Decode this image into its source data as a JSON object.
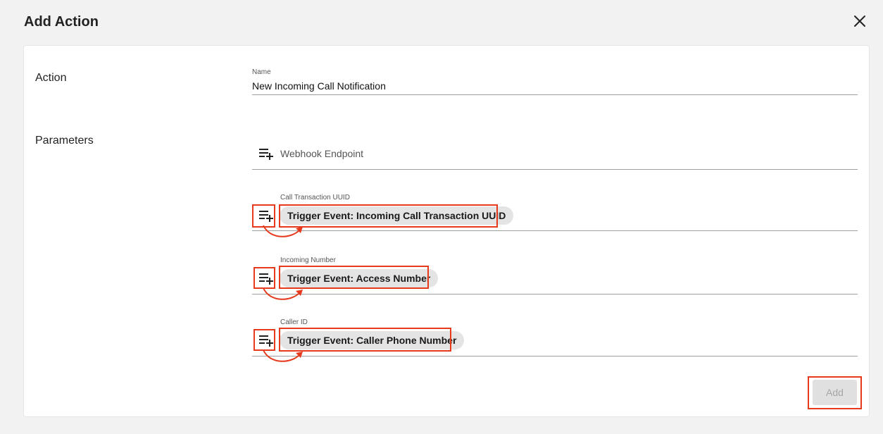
{
  "dialog": {
    "title": "Add Action",
    "close_icon": "close-icon"
  },
  "action_section": {
    "label": "Action",
    "name_field": {
      "label": "Name",
      "value": "New Incoming Call Notification"
    }
  },
  "parameters_section": {
    "label": "Parameters",
    "params": [
      {
        "label": "",
        "placeholder": "Webhook Endpoint",
        "chip": ""
      },
      {
        "label": "Call Transaction UUID",
        "placeholder": "",
        "chip": "Trigger Event: Incoming Call Transaction UUID"
      },
      {
        "label": "Incoming Number",
        "placeholder": "",
        "chip": "Trigger Event: Access Number"
      },
      {
        "label": "Caller ID",
        "placeholder": "",
        "chip": "Trigger Event: Caller Phone Number"
      }
    ]
  },
  "footer": {
    "add_label": "Add"
  },
  "colors": {
    "highlight": "#e63a1e",
    "chip_bg": "#e4e4e4",
    "disabled_button": "#e0e0e0"
  }
}
